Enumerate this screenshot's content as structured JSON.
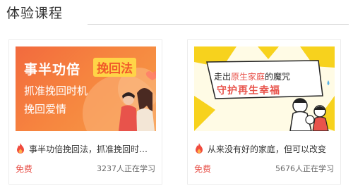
{
  "section": {
    "title": "体验课程"
  },
  "cards": [
    {
      "title": "事半功倍挽回法，抓准挽回时机，挽回爱情",
      "price": "免费",
      "learners": "3237人正在学习",
      "poster": {
        "line1": "事半功倍",
        "badge": "挽回法",
        "line2": "抓准挽回时机",
        "line3": "挽回爱情"
      }
    },
    {
      "title": "从来没有好的家庭，但可以改变",
      "price": "免费",
      "learners": "5676人正在学习",
      "poster": {
        "line1_pre": "走出",
        "line1_mid": "原生家庭",
        "line1_post": "的魔咒",
        "line2": "守护再生幸福"
      }
    }
  ],
  "colors": {
    "accent": "#e8534b",
    "poster1_bg": "#f6843f",
    "poster2_yellow": "#f7d21d"
  }
}
